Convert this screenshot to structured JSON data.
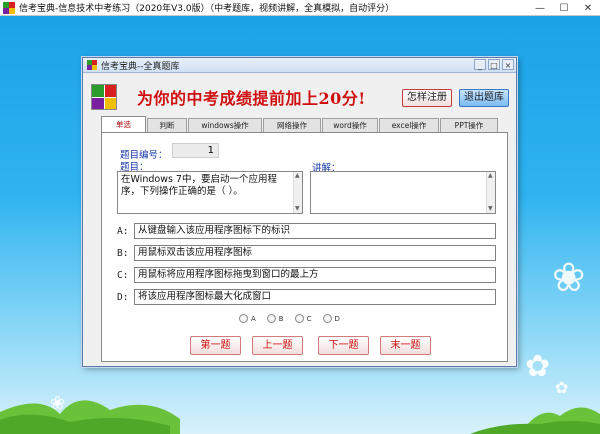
{
  "app": {
    "title": "信考宝典-信息技术中考练习（2020年V3.0版）（中考题库，视频讲解，全真模拟，自动评分）",
    "controls": {
      "minimize": "—",
      "maximize": "☐",
      "close": "✕"
    }
  },
  "dialog": {
    "title": "信考宝典--全真题库",
    "controls": {
      "minimize": "_",
      "maximize": "□",
      "close": "×"
    },
    "slogan": "为你的中考成绩提前加上20分!",
    "register_button": "怎样注册",
    "exit_button": "退出题库",
    "tabs": [
      {
        "label": "单选",
        "active": true
      },
      {
        "label": "判断",
        "active": false
      },
      {
        "label": "windows操作",
        "active": false
      },
      {
        "label": "网络操作",
        "active": false
      },
      {
        "label": "word操作",
        "active": false
      },
      {
        "label": "excel操作",
        "active": false
      },
      {
        "label": "PPT操作",
        "active": false
      }
    ],
    "question_number_label": "题目编号：",
    "question_number": "1",
    "question_label": "题目：",
    "explanation_label": "讲解：",
    "question_text": "在Windows 7中，要启动一个应用程序，下列操作正确的是（ ）。",
    "explanation_text": "",
    "options": [
      {
        "letter": "A:",
        "text": "从键盘输入该应用程序图标下的标识"
      },
      {
        "letter": "B:",
        "text": "用鼠标双击该应用程序图标"
      },
      {
        "letter": "C:",
        "text": "用鼠标将应用程序图标拖曳到窗口的最上方"
      },
      {
        "letter": "D:",
        "text": "将该应用程序图标最大化成窗口"
      }
    ],
    "answer_radios": [
      "A",
      "B",
      "C",
      "D"
    ],
    "nav_buttons": {
      "first": "第一题",
      "prev": "上一题",
      "next": "下一题",
      "last": "末一题"
    }
  },
  "colors": {
    "slogan": "#d01010",
    "label_blue": "#1b3aa8",
    "nav_text": "#cc1010",
    "logo": [
      "#2a9d2a",
      "#d82020",
      "#7a1fa0",
      "#f0c000"
    ]
  },
  "icons": [
    "app-logo-icon",
    "dialog-logo-icon",
    "brand-logo-icon",
    "flower-icon"
  ]
}
